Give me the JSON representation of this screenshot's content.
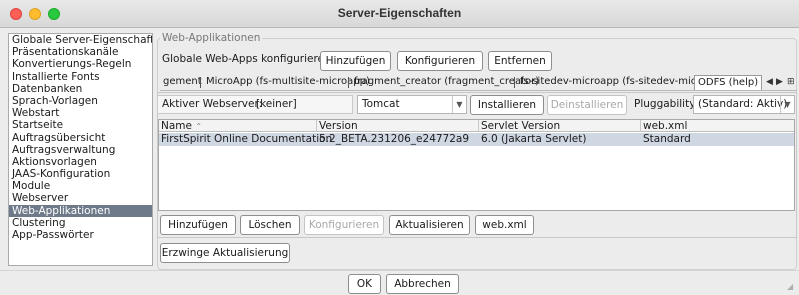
{
  "window": {
    "title": "Server-Eigenschaften"
  },
  "sidebar": {
    "items": [
      {
        "label": "Globale Server-Eigenschaften"
      },
      {
        "label": "Präsentationskanäle"
      },
      {
        "label": "Konvertierungs-Regeln"
      },
      {
        "label": "Installierte Fonts"
      },
      {
        "label": "Datenbanken"
      },
      {
        "label": "Sprach-Vorlagen"
      },
      {
        "label": "Webstart"
      },
      {
        "label": "Startseite"
      },
      {
        "label": "Auftragsübersicht"
      },
      {
        "label": "Auftragsverwaltung"
      },
      {
        "label": "Aktionsvorlagen"
      },
      {
        "label": "JAAS-Konfiguration"
      },
      {
        "label": "Module"
      },
      {
        "label": "Webserver"
      },
      {
        "label": "Web-Applikationen",
        "selected": true
      },
      {
        "label": "Clustering"
      },
      {
        "label": "App-Passwörter"
      }
    ]
  },
  "main": {
    "group_title": "Web-Applikationen",
    "global_label": "Globale Web-Apps konfigurieren:",
    "global_buttons": {
      "add": "Hinzufügen",
      "configure": "Konfigurieren",
      "remove": "Entfernen"
    },
    "tabs": [
      {
        "label": "gement"
      },
      {
        "label": "MicroApp (fs-multisite-microapp)"
      },
      {
        "label": "fragment_creator (fragment_creator)"
      },
      {
        "label": "fs-sitedev-microapp (fs-sitedev-microapp)"
      },
      {
        "label": "ODFS (help)",
        "active": true
      }
    ],
    "tab_controls": {
      "prev": "◀",
      "next": "▶",
      "menu": "⊞"
    },
    "webserver": {
      "label": "Aktiver Webserver:",
      "value": "[keiner]",
      "type": "Tomcat",
      "install": "Installieren",
      "uninstall": "Deinstallieren",
      "pluggability_label": "Pluggability:",
      "pluggability_value": "(Standard: Aktiv)"
    },
    "table": {
      "columns": [
        "Name",
        "Version",
        "Servlet Version",
        "web.xml"
      ],
      "sort_indicator": "⌃",
      "rows": [
        [
          "FirstSpirit Online Documentation",
          "5.2_BETA.231206_e24772a9",
          "6.0 (Jakarta Servlet)",
          "Standard"
        ]
      ]
    },
    "table_buttons": {
      "add": "Hinzufügen",
      "delete": "Löschen",
      "configure": "Konfigurieren",
      "update": "Aktualisieren",
      "webxml": "web.xml"
    },
    "force_update": "Erzwinge Aktualisierung"
  },
  "footer": {
    "ok": "OK",
    "cancel": "Abbrechen"
  },
  "colors": {
    "selection": "#6e7a8a",
    "row_highlight": "#cfd7e3"
  }
}
